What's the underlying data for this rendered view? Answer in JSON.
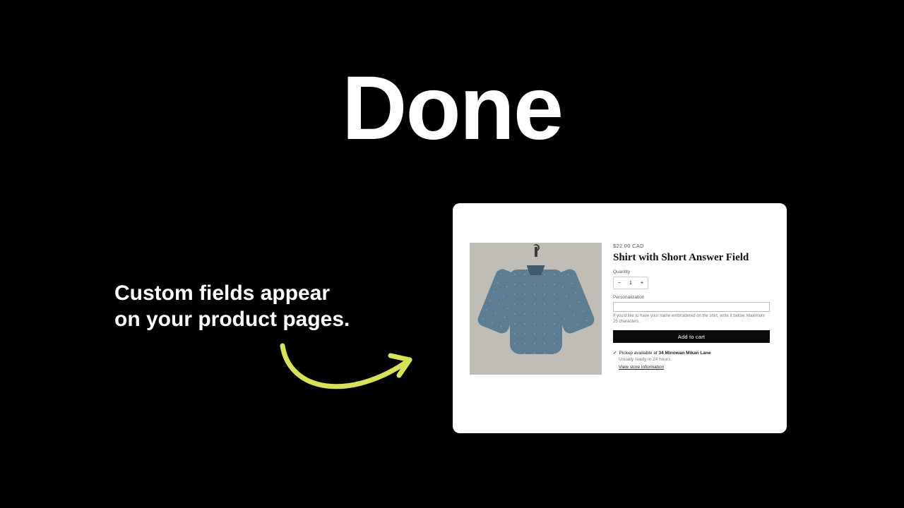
{
  "slide": {
    "headline": "Done",
    "caption_line1": "Custom fields appear",
    "caption_line2": "on your product pages."
  },
  "product": {
    "price": "$22.00 CAD",
    "title": "Shirt with Short Answer Field",
    "quantity_label": "Quantity",
    "quantity_value": "1",
    "minus": "−",
    "plus": "+",
    "personalization_label": "Personalization",
    "personalization_value": "",
    "personalization_hint": "If you'd like to have your name embroidered on the shirt, write it below. Maximum 25 characters.",
    "add_to_cart": "Add to cart",
    "pickup": {
      "check": "✓",
      "prefix": "Pickup available at ",
      "location": "34 Minowan Mikan Lane",
      "eta": "Usually ready in 24 hours",
      "link": "View store information"
    }
  },
  "colors": {
    "arrow": "#d7e25a"
  }
}
